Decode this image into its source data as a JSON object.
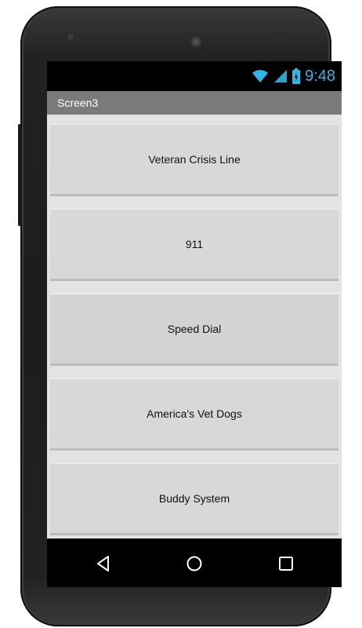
{
  "status_bar": {
    "time": "9:48",
    "icons": [
      "wifi-icon",
      "cellular-signal-icon",
      "battery-icon"
    ],
    "accent_color": "#33b5e5"
  },
  "title_bar": {
    "title": "Screen3"
  },
  "buttons": [
    {
      "label": "Veteran Crisis Line"
    },
    {
      "label": "911"
    },
    {
      "label": "Speed Dial"
    },
    {
      "label": "America's Vet Dogs"
    },
    {
      "label": "Buddy System"
    }
  ],
  "nav_bar": {
    "icons": [
      "back-icon",
      "home-icon",
      "recents-icon"
    ]
  }
}
